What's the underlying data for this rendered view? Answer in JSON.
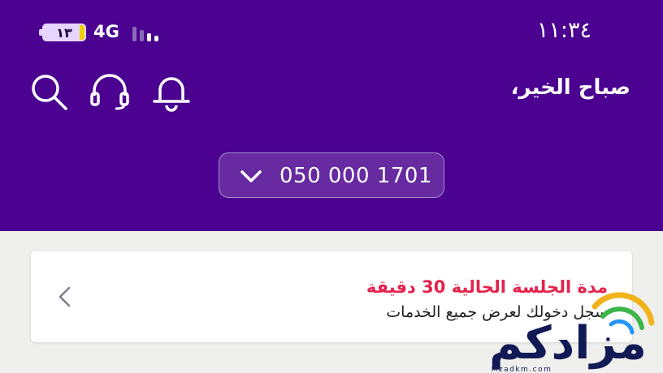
{
  "status_bar": {
    "time": "١١:٣٤",
    "battery_level": "١٣",
    "network_type": "4G"
  },
  "header": {
    "greeting": "صباح الخير،",
    "phone_number": "050 000 1701",
    "icons": [
      "bell-icon",
      "headset-icon",
      "search-icon"
    ]
  },
  "session_card": {
    "title": "مدة الجلسة الحالية 30 دقيقة",
    "subtitle": "سجل دخولك لعرض جميع الخدمات"
  },
  "watermark": {
    "brand_text": "مزادكم",
    "url_text": "Mzadkm.com"
  },
  "colors": {
    "header_bg": "#4b0290",
    "accent_red": "#e5234d",
    "page_bg": "#efefed"
  }
}
